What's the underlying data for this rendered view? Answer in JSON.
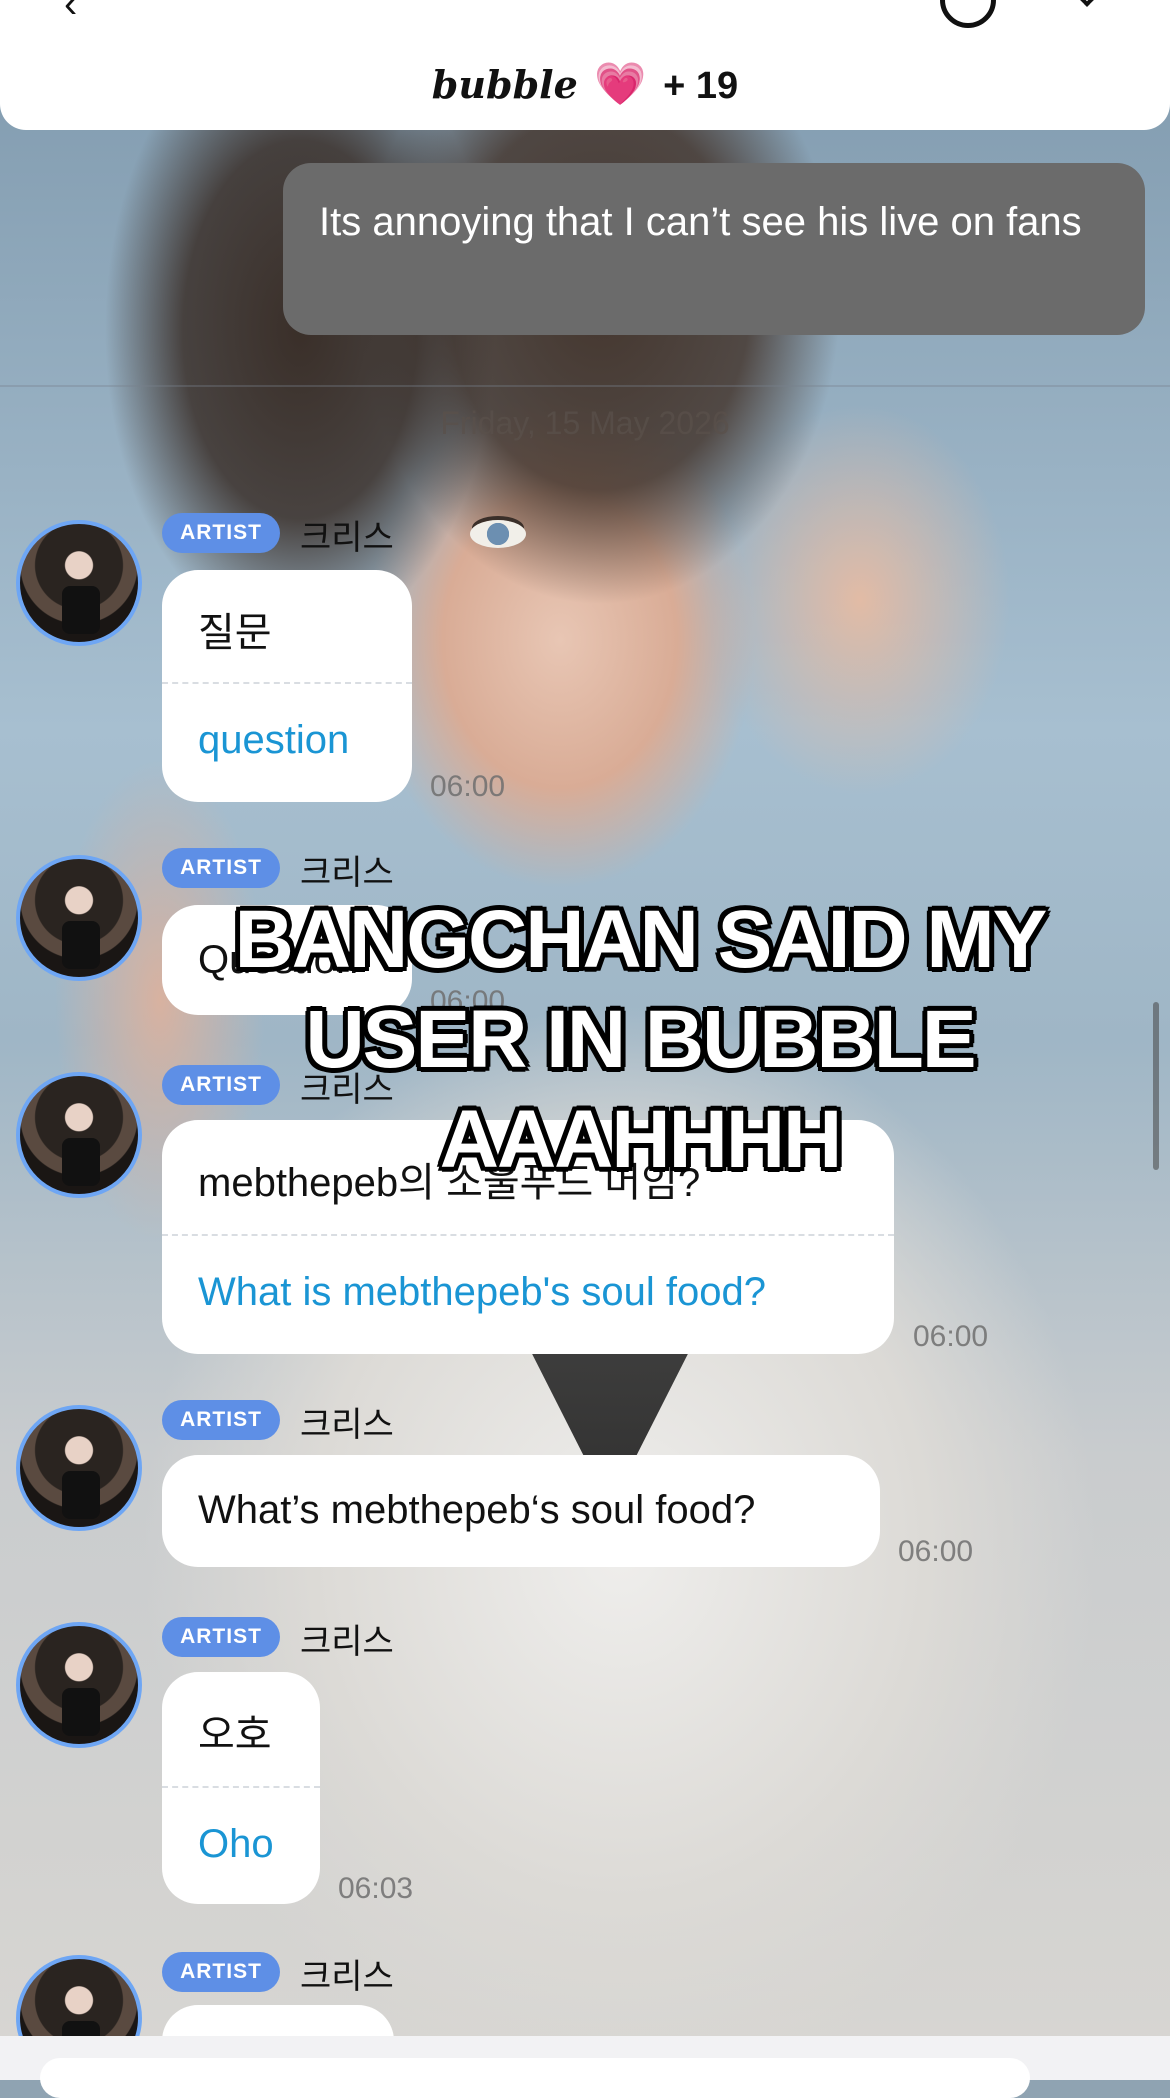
{
  "header": {
    "brand": "bubble",
    "heart": "💗",
    "count": "+ 19"
  },
  "quoted_message": {
    "text": "Its annoying that I can’t see his live on fans"
  },
  "date_separator": "Friday, 15 May 2026",
  "overlay_caption": "BANGCHAN SAID MY USER IN BUBBLE AAAHHHH",
  "messages": [
    {
      "badge": "ARTIST",
      "sender": "크리스",
      "korean": "질문",
      "english": "question",
      "time": "06:00"
    },
    {
      "badge": "ARTIST",
      "sender": "크리스",
      "text": "Question",
      "time": "06:00"
    },
    {
      "badge": "ARTIST",
      "sender": "크리스",
      "korean": "mebthepeb의 소울푸드 머임?",
      "english": "What is mebthepeb's soul food?",
      "time": "06:00"
    },
    {
      "badge": "ARTIST",
      "sender": "크리스",
      "text": "What’s mebthepeb‘s soul food?",
      "time": "06:00"
    },
    {
      "badge": "ARTIST",
      "sender": "크리스",
      "korean": "오호",
      "english": "Oho",
      "time": "06:03"
    },
    {
      "badge": "ARTIST",
      "sender": "크리스"
    }
  ],
  "colors": {
    "badge": "#5e8fe6",
    "translation": "#1a95d4",
    "quote_bubble": "#6b6b6b",
    "avatar_ring": "#6ea6f4"
  }
}
